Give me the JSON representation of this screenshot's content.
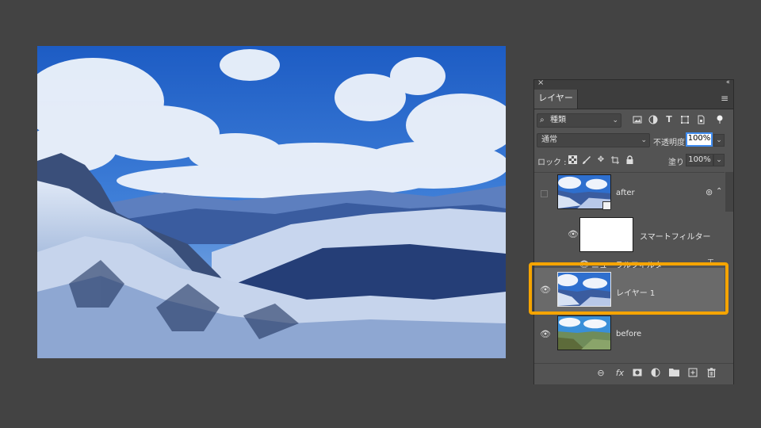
{
  "panel": {
    "close_glyph": "×",
    "collapse_glyph": "‹‹",
    "tab_label": "レイヤー",
    "menu_glyph": "≡"
  },
  "filter": {
    "search_icon": "search-icon",
    "kind_value": "種類",
    "icons": [
      "image-filter-icon",
      "adjustment-filter-icon",
      "type-filter-icon",
      "shape-filter-icon",
      "smart-object-filter-icon",
      "filter-toggle-icon"
    ]
  },
  "blend": {
    "mode_value": "通常",
    "opacity_label": "不透明度 :",
    "opacity_value": "100%"
  },
  "lock": {
    "label": "ロック :",
    "icons": [
      "lock-transparency-icon",
      "lock-pixels-icon",
      "lock-position-icon",
      "lock-artboard-icon",
      "lock-all-icon"
    ],
    "fill_label": "塗り :",
    "fill_value": "100%"
  },
  "layers": [
    {
      "name": "after",
      "visible": false,
      "type": "smart-object"
    },
    {
      "name": "スマートフィルター",
      "visible": true,
      "type": "smart-filter"
    },
    {
      "name": "ニューラルフィルター",
      "visible": true,
      "type": "filter"
    },
    {
      "name": "レイヤー 1",
      "visible": true,
      "selected": true
    },
    {
      "name": "before",
      "visible": true
    }
  ],
  "bottom_icons": [
    "link-layers-icon",
    "fx-icon",
    "add-mask-icon",
    "adjustment-layer-icon",
    "group-folder-icon",
    "new-layer-icon",
    "trash-icon"
  ],
  "colors": {
    "background": "#434343",
    "panel": "#535353",
    "highlight": "#f5a400",
    "opacity_focus": "#3f8cf0"
  }
}
